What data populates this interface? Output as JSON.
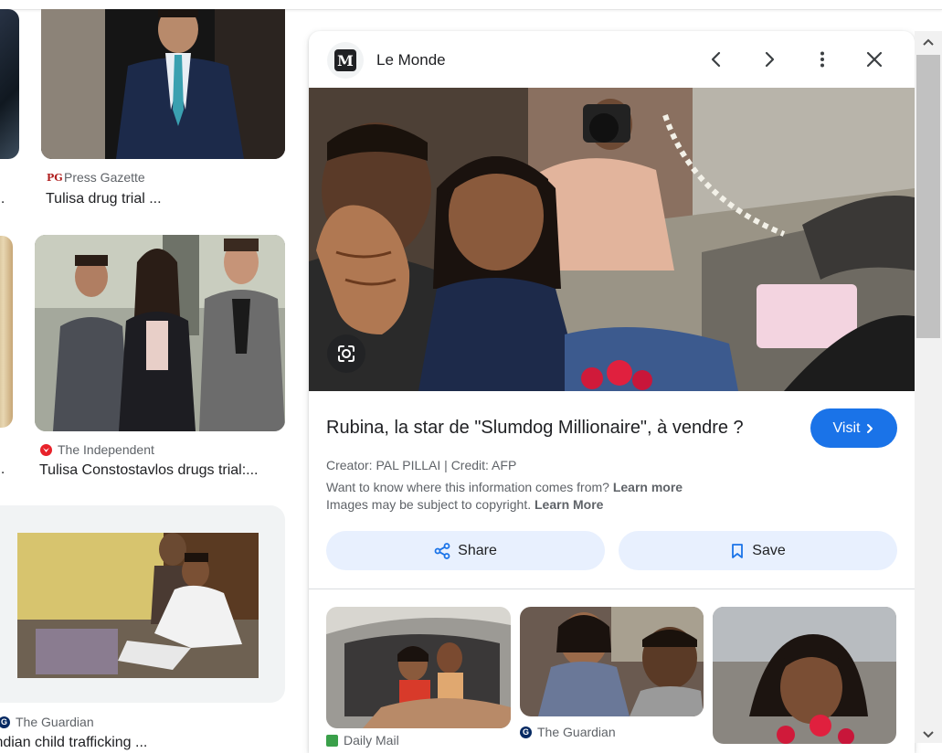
{
  "left_results": [
    {
      "source": "Press Gazette",
      "title": "Tulisa drug trial ..."
    },
    {
      "source": "The Independent",
      "title": "Tulisa Constostavlos drugs trial:..."
    },
    {
      "source": "The Guardian",
      "title": "Indian child trafficking ..."
    }
  ],
  "left_partial_titles": [
    "...",
    "..."
  ],
  "panel": {
    "source_name": "Le Monde",
    "logo_letter": "M",
    "title": "Rubina, la star de \"Slumdog Millionaire\", à vendre ?",
    "visit_label": "Visit",
    "creator": "Creator: PAL PILLAI | Credit: AFP",
    "info_text": "Want to know where this information comes from?",
    "info_link": "Learn more",
    "copyright_text": "Images may be subject to copyright.",
    "copyright_link": "Learn More",
    "share_label": "Share",
    "save_label": "Save"
  },
  "related": [
    {
      "source": "Daily Mail"
    },
    {
      "source": "The Guardian"
    }
  ],
  "icons": {
    "prev": "chevron-left-icon",
    "next": "chevron-right-icon",
    "more": "more-vert-icon",
    "close": "close-icon",
    "lens": "google-lens-icon",
    "share": "share-icon",
    "save": "bookmark-icon"
  },
  "colors": {
    "accent": "#1a73e8",
    "pill": "#e8f0fe",
    "text": "#202124",
    "muted": "#5f6368"
  }
}
